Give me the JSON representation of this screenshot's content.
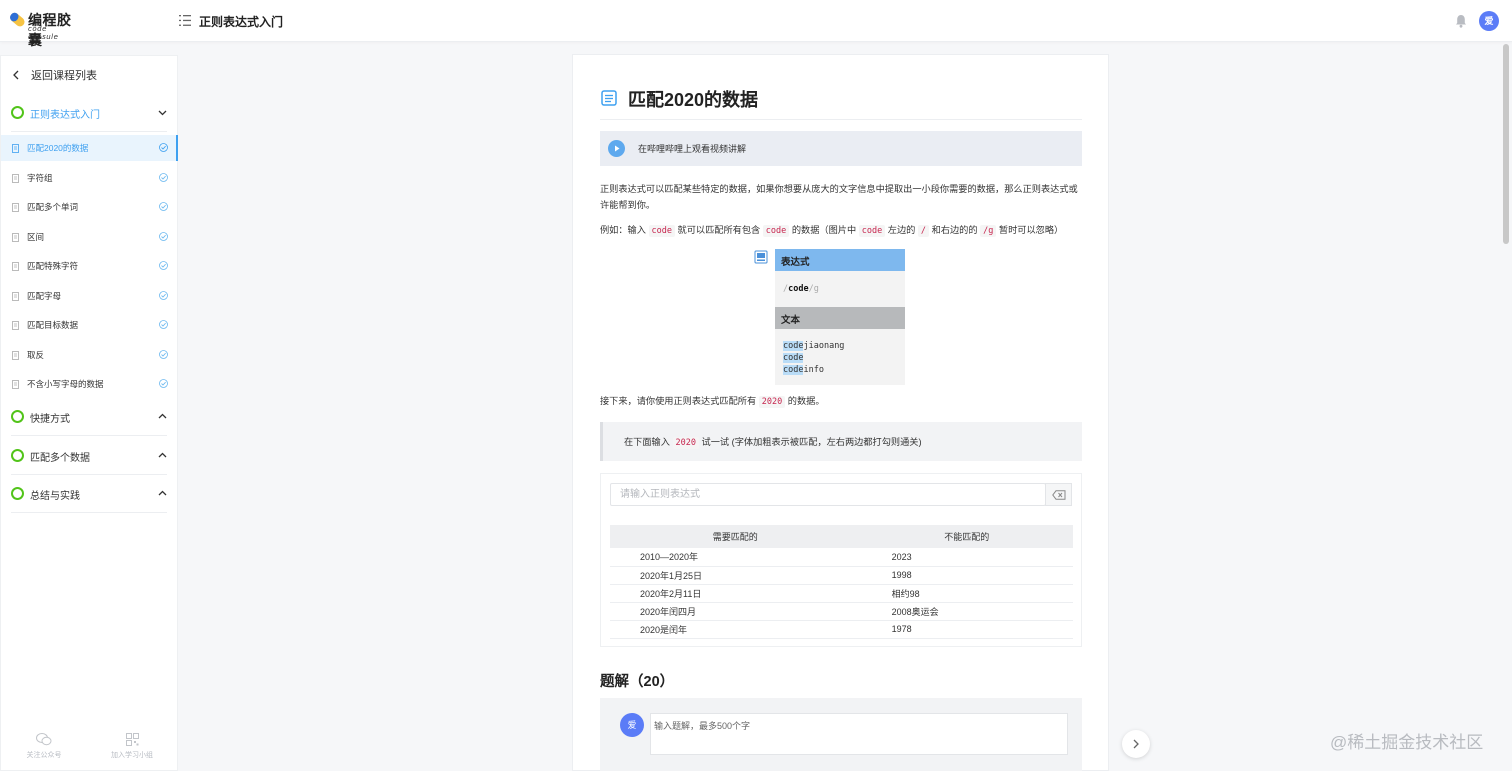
{
  "app": {
    "logo_cn": "编程胶囊",
    "logo_en": "code capsule",
    "course_title": "正则表达式入门",
    "user_initial": "爱"
  },
  "sidebar": {
    "back_label": "返回课程列表",
    "sections": [
      {
        "label": "正则表达式入门",
        "expanded": true,
        "active": true
      },
      {
        "label": "快捷方式",
        "expanded": false
      },
      {
        "label": "匹配多个数据",
        "expanded": false
      },
      {
        "label": "总结与实践",
        "expanded": false
      }
    ],
    "lessons": [
      {
        "label": "匹配2020的数据",
        "active": true
      },
      {
        "label": "字符组"
      },
      {
        "label": "匹配多个单词"
      },
      {
        "label": "区间"
      },
      {
        "label": "匹配特殊字符"
      },
      {
        "label": "匹配字母"
      },
      {
        "label": "匹配目标数据"
      },
      {
        "label": "取反"
      },
      {
        "label": "不含小写字母的数据"
      }
    ],
    "footer": {
      "follow_label": "关注公众号",
      "group_label": "加入学习小组"
    }
  },
  "lesson": {
    "title": "匹配2020的数据",
    "video_text": "在哔哩哔哩上观看视频讲解",
    "intro": "正则表达式可以匹配某些特定的数据，如果你想要从庞大的文字信息中提取出一小段你需要的数据，那么正则表达式或许能帮到你。",
    "example": {
      "prefix": "例如：输入",
      "code1": "code",
      "mid1": "就可以匹配所有包含",
      "code2": "code",
      "mid2": "的数据（图片中",
      "code3": "code",
      "mid3": "左边的",
      "code4": "/",
      "mid4": "和右边的的",
      "code5": "/g",
      "suffix": "暂时可以忽略）"
    },
    "demo": {
      "expr_header": "表达式",
      "expr_prefix": "/",
      "expr_body": "code",
      "expr_suffix": "/g",
      "text_header": "文本",
      "lines": [
        {
          "hl": "code",
          "rest": "jiaonang"
        },
        {
          "hl": "code",
          "rest": ""
        },
        {
          "hl": "code",
          "rest": "info"
        }
      ]
    },
    "task": {
      "prefix": "接下来，请你使用正则表达式匹配所有",
      "code": "2020",
      "suffix": "的数据。"
    },
    "hint": {
      "prefix": "在下面输入",
      "code": "2020",
      "suffix": "试一试  (字体加粗表示被匹配，左右两边都打勾则通关)"
    },
    "regex_placeholder": "请输入正则表达式",
    "table": {
      "headers": [
        "需要匹配的",
        "不能匹配的"
      ],
      "rows": [
        [
          "2010—2020年",
          "2023"
        ],
        [
          "2020年1月25日",
          "1998"
        ],
        [
          "2020年2月11日",
          "相约98"
        ],
        [
          "2020年闰四月",
          "2008奥运会"
        ],
        [
          "2020是闰年",
          "1978"
        ]
      ]
    },
    "answers_title": "题解（20）",
    "comment_placeholder": "输入题解，最多500个字"
  },
  "watermark": "@稀土掘金技术社区",
  "colors": {
    "accent": "#3ea0f0",
    "success": "#52c41a",
    "avatar": "#5b7cf7",
    "demo_header": "#7eb8ee",
    "code_text": "#c7254e"
  }
}
